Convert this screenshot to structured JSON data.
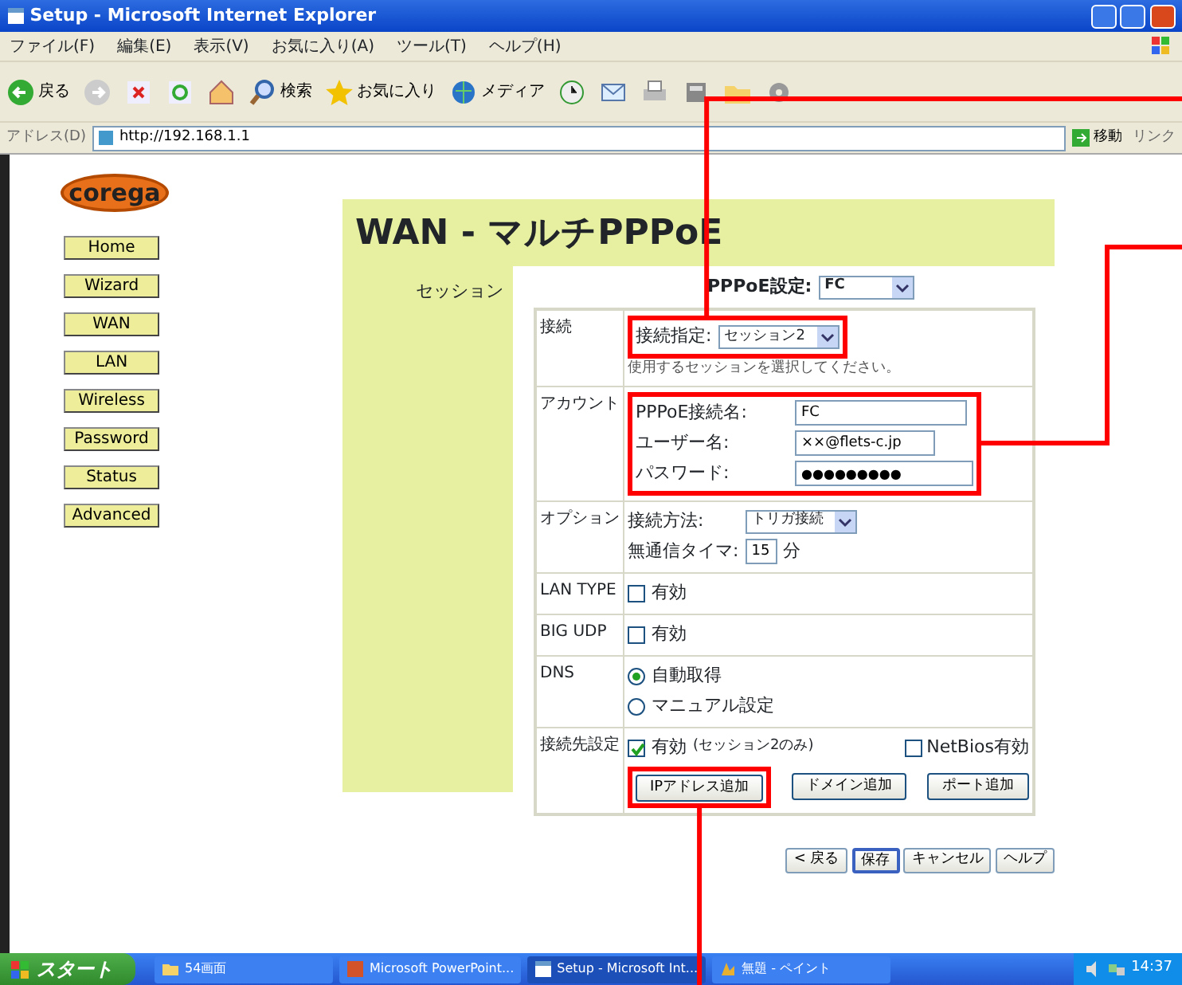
{
  "window": {
    "title": "Setup - Microsoft Internet Explorer"
  },
  "menu": [
    "ファイル(F)",
    "編集(E)",
    "表示(V)",
    "お気に入り(A)",
    "ツール(T)",
    "ヘルプ(H)"
  ],
  "toolbar": [
    {
      "kind": "back",
      "label": "戻る"
    },
    {
      "kind": "forward"
    },
    {
      "kind": "stop"
    },
    {
      "kind": "refresh"
    },
    {
      "kind": "home"
    },
    {
      "kind": "search",
      "label": "検索"
    },
    {
      "kind": "favorites",
      "label": "お気に入り"
    },
    {
      "kind": "media",
      "label": "メディア"
    },
    {
      "kind": "history"
    },
    {
      "kind": "mail"
    },
    {
      "kind": "print"
    },
    {
      "kind": "edit"
    },
    {
      "kind": "folder"
    },
    {
      "kind": "messenger"
    }
  ],
  "address_bar": {
    "label": "アドレス(D)",
    "value": "http://192.168.1.1",
    "go": "移動",
    "links": "リンク"
  },
  "logo": "corega",
  "nav": [
    "Home",
    "Wizard",
    "WAN",
    "LAN",
    "Wireless",
    "Password",
    "Status",
    "Advanced"
  ],
  "page_title": "WAN - マルチPPPoE",
  "section_label": "セッション",
  "pppoe_setting": {
    "label": "PPPoE設定:",
    "value": "FC"
  },
  "rows": [
    {
      "label": "接続",
      "kind": "connection",
      "field_label": "接続指定:",
      "value": "セッション2",
      "hint": "使用するセッションを選択してください。",
      "highlighted": true
    },
    {
      "label": "アカウント",
      "kind": "account",
      "highlighted": true,
      "fields": [
        {
          "label": "PPPoE接続名:",
          "value": "FC"
        },
        {
          "label": "ユーザー名:",
          "value": "××@flets-c.jp"
        },
        {
          "label": "パスワード:",
          "value": "●●●●●●●●●"
        }
      ]
    },
    {
      "label": "オプション",
      "kind": "options",
      "method_label": "接続方法:",
      "method": "トリガ接続",
      "timer_label": "無通信タイマ:",
      "timer": "15",
      "unit": "分"
    },
    {
      "label": "LAN TYPE",
      "kind": "checkbox",
      "text": "有効",
      "checked": false
    },
    {
      "label": "BIG UDP",
      "kind": "checkbox",
      "text": "有効",
      "checked": false
    },
    {
      "label": "DNS",
      "kind": "radio",
      "options": [
        {
          "text": "自動取得",
          "selected": true
        },
        {
          "text": "マニュアル設定",
          "selected": false
        }
      ]
    },
    {
      "label": "接続先設定",
      "kind": "destination",
      "enable": {
        "text": "有効",
        "note": "(セッション2のみ)",
        "checked": true
      },
      "netbios": {
        "text": "NetBios有効",
        "checked": false
      },
      "buttons": [
        {
          "label": "IPアドレス追加",
          "highlighted": true
        },
        {
          "label": "ドメイン追加",
          "highlighted": false
        },
        {
          "label": "ポート追加",
          "highlighted": false
        }
      ]
    }
  ],
  "actions": [
    {
      "label": "< 戻る",
      "focused": false
    },
    {
      "label": "保存",
      "focused": true
    },
    {
      "label": "キャンセル",
      "focused": false
    },
    {
      "label": "ヘルプ",
      "focused": false
    }
  ],
  "taskbar": {
    "start": "スタート",
    "tasks": [
      {
        "label": "54画面",
        "active": false
      },
      {
        "label": "Microsoft PowerPoint...",
        "active": false
      },
      {
        "label": "Setup - Microsoft Int...",
        "active": true
      },
      {
        "label": "無題 - ペイント",
        "active": false
      }
    ],
    "clock": "14:37"
  }
}
